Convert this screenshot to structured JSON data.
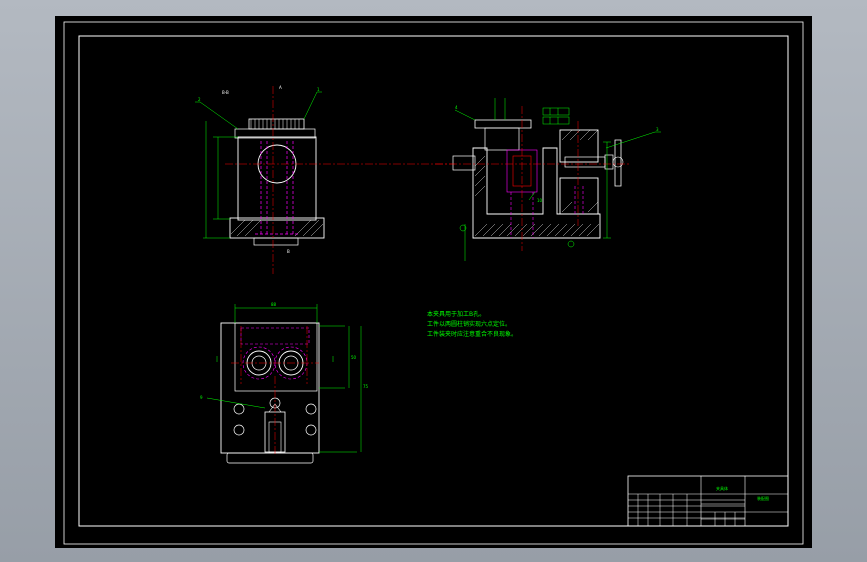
{
  "drawing": {
    "background": "#000000",
    "line_color": "#ffffff",
    "dimension_color": "#00ff00",
    "center_line_color": "#ff0000",
    "hidden_line_color": "#ff00ff"
  },
  "section_label": "B-B",
  "tech_notes": [
    "本夹具用于加工B孔。",
    "工件以两圆柱销实现六点定位。",
    "工件装夹时应注意重合不良现象。"
  ],
  "title_block": {
    "part_name": "夹具体",
    "drawing_name": "装配图"
  }
}
